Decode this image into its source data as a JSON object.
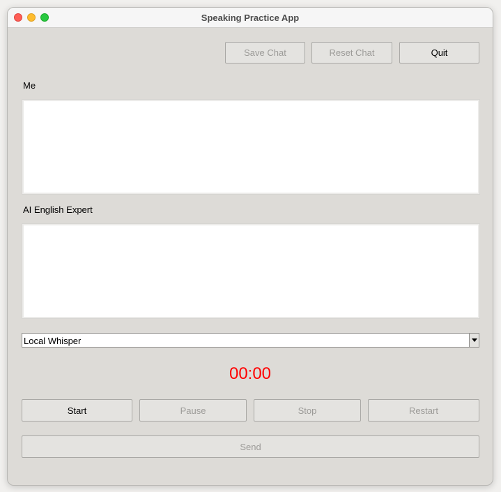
{
  "window": {
    "title": "Speaking Practice App"
  },
  "toolbar": {
    "save_chat": "Save Chat",
    "reset_chat": "Reset Chat",
    "quit": "Quit"
  },
  "me": {
    "label": "Me",
    "text": ""
  },
  "expert": {
    "label": "AI English Expert",
    "text": ""
  },
  "engine": {
    "selected": "Local Whisper"
  },
  "timer": {
    "value": "00:00",
    "color": "#ff0000"
  },
  "controls": {
    "start": "Start",
    "pause": "Pause",
    "stop": "Stop",
    "restart": "Restart",
    "send": "Send"
  }
}
